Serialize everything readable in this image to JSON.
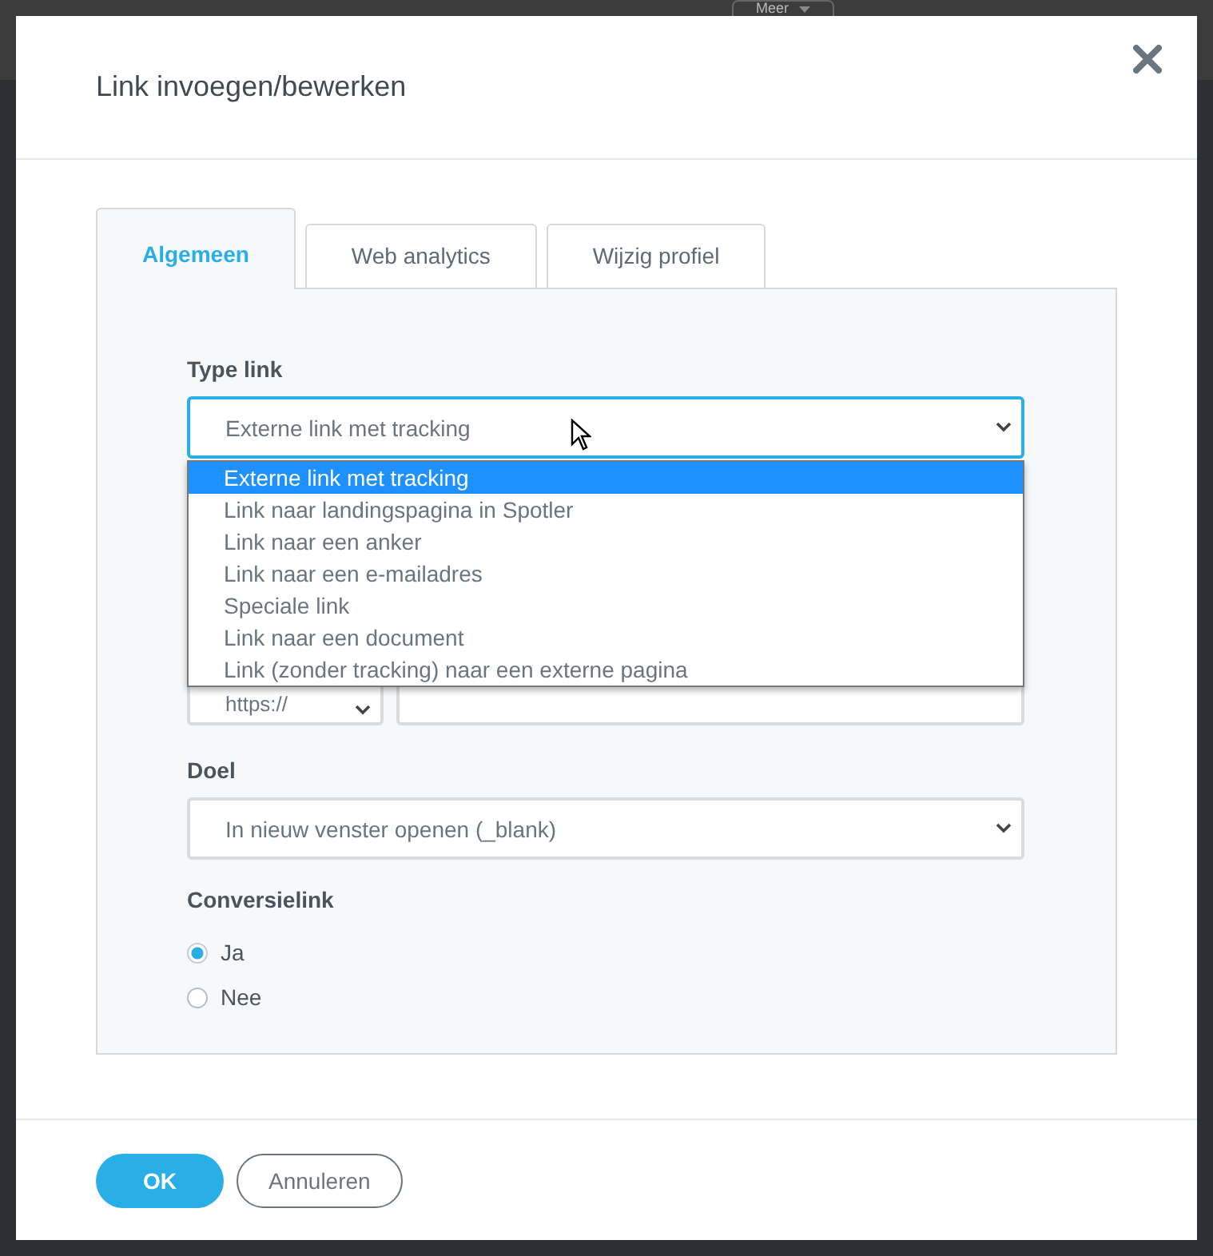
{
  "background": {
    "toolbar_button": "Meer"
  },
  "dialog": {
    "title": "Link invoegen/bewerken"
  },
  "tabs": [
    {
      "label": "Algemeen",
      "selected": true
    },
    {
      "label": "Web analytics",
      "selected": false
    },
    {
      "label": "Wijzig profiel",
      "selected": false
    }
  ],
  "type_link": {
    "label": "Type link",
    "value": "Externe link met tracking",
    "expanded": true,
    "options": [
      {
        "label": "Externe link met tracking",
        "selected": true
      },
      {
        "label": "Link naar landingspagina in Spotler",
        "selected": false
      },
      {
        "label": "Link naar een anker",
        "selected": false
      },
      {
        "label": "Link naar een e-mailadres",
        "selected": false
      },
      {
        "label": "Speciale link",
        "selected": false
      },
      {
        "label": "Link naar een document",
        "selected": false
      },
      {
        "label": "Link (zonder tracking) naar een externe pagina",
        "selected": false
      }
    ]
  },
  "url": {
    "protocol": "https://"
  },
  "target": {
    "label": "Doel",
    "value": "In nieuw venster openen (_blank)"
  },
  "conversion": {
    "label": "Conversielink",
    "options": [
      {
        "label": "Ja",
        "selected": true
      },
      {
        "label": "Nee",
        "selected": false
      }
    ]
  },
  "buttons": [
    {
      "label": "OK",
      "kind": "primary"
    },
    {
      "label": "Annuleren",
      "kind": "secondary"
    }
  ]
}
